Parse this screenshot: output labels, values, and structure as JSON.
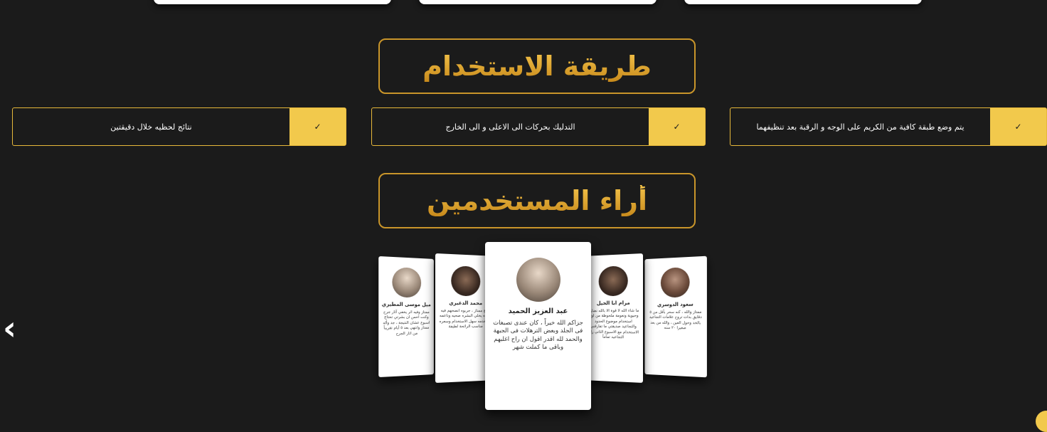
{
  "usage_section": {
    "title": "طريقة الاستخدام",
    "steps": [
      {
        "text": "يتم وضع طبقة كافية من الكريم على الوجه و الرقبة بعد تنظيفهما",
        "icon": "check-icon"
      },
      {
        "text": "التدليك بحركات الى الاعلى و الى الخارج",
        "icon": "check-icon"
      },
      {
        "text": "نتائج لحظيه خلال دقيقتين",
        "icon": "check-icon"
      }
    ]
  },
  "reviews_section": {
    "title": "أراء المستخدمين",
    "reviews": [
      {
        "name": "ميل موسى المطيري",
        "text": "ممتاز وفيه اثر يخفي آثار جرح وكنت احس ان بشرتي تحتاج اسبوع عشان النتيجة ، جد وأله ممتاز وانتهي بعد ٥ أيام تقريباً من اثار الجرح"
      },
      {
        "name": "محمد الدغيري",
        "text": "منتج ممتاز ، جربوه انصحهم فيه بشده يخلي البشره صحيه وناعمه تستخدمه سهل الاستخدام وسعره مناسب الرائحة لطيفة"
      },
      {
        "name": "عبد العزيز الحميد",
        "text": "جزاكم الله خيراً ، كان عندى تصبغات فى الجلد وبعض الترهلات فى الجبهة والحمد لله اقدر اقول ان راح اغلبهم وباقى ما كملت شهر"
      },
      {
        "name": "مرام ابا الخيل",
        "text": "ما شاء الله لا قوة الا بالله نضارة وحيوية ونعومة ملحوظة من اول استخدام موضوع الحدود والتجاعيد صديقتي ما تفارقني الاستخدام مع الاسبوع الثاني راح التجاعيد تماماً"
      },
      {
        "name": "سعود الدوسري",
        "text": "ممتاز والله ، كنه سحر بأقل من ٥ دقايق بدات تروح علامات التجاعيد بالخد وحول العين ، والله من بعد صغيرا ٢٠ سنه"
      }
    ],
    "prev_icon": "chevron-left-icon"
  },
  "colors": {
    "background": "#1b1b1b",
    "accent": "#f2c94c",
    "border_gold": "#c9952a"
  }
}
